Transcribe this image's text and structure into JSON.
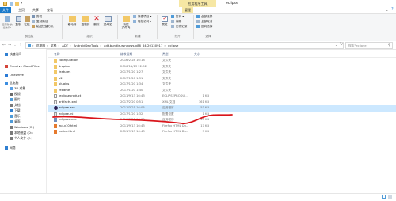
{
  "window": {
    "title": "eclipse",
    "context_tab_label": "应用程序工具",
    "accent": "#1979ca",
    "context_color": "#f6e7a4",
    "selection_color": "#cce8ff",
    "annotation_color": "#d9151b"
  },
  "tabs": [
    "文件",
    "主页",
    "共享",
    "查看",
    "管理"
  ],
  "ribbon": {
    "clipboard": {
      "pin_label": "固定到\"快速访问\"",
      "copy_label": "复制",
      "paste_label": "粘贴",
      "cut_label": "剪切",
      "copy_path_label": "复制路径",
      "paste_shortcut_label": "粘贴快捷方式",
      "group_label": "剪贴板"
    },
    "organize": {
      "move_to_label": "移动到",
      "copy_to_label": "复制到",
      "delete_label": "删除",
      "rename_label": "重命名",
      "group_label": "组织"
    },
    "new": {
      "new_folder_label": "新建\n文件夹",
      "new_item_label": "新建项目 ▾",
      "easy_access_label": "轻松访问 ▾",
      "group_label": "新建"
    },
    "open": {
      "properties_label": "属性",
      "open_label": "打开 ▾",
      "edit_label": "编辑",
      "history_label": "历史记录",
      "group_label": "打开"
    },
    "select": {
      "select_all_label": "全部选择",
      "select_none_label": "全部取消",
      "invert_label": "反向选择",
      "group_label": "选择"
    }
  },
  "address": {
    "segments": [
      "此电脑",
      "文档",
      "ADT",
      "AndroidDevTools",
      "adt-bundle-windows-x86_64-20130917",
      "eclipse"
    ],
    "separator": "›",
    "search_placeholder": "搜索\"eclipse\""
  },
  "nav_items": [
    {
      "label": "快速访问",
      "icon": "star-icon",
      "color": "#2f7fd1"
    },
    {
      "label": "Creative Cloud Files",
      "icon": "cloud-icon",
      "color": "#d4453a"
    },
    {
      "label": "OneDrive",
      "icon": "onedrive-icon",
      "color": "#2a7ad6"
    },
    {
      "label": "此电脑",
      "icon": "computer-icon",
      "color": "#3c8ee0"
    },
    {
      "label": "3D 对象",
      "icon": "cube-icon",
      "color": "#5aa0e6"
    },
    {
      "label": "视频",
      "icon": "video-icon",
      "color": "#6a6a6a"
    },
    {
      "label": "图片",
      "icon": "picture-icon",
      "color": "#4f9bd8"
    },
    {
      "label": "文档",
      "icon": "document-icon",
      "color": "#7a7a7a"
    },
    {
      "label": "下载",
      "icon": "download-icon",
      "color": "#2f7fd1"
    },
    {
      "label": "音乐",
      "icon": "music-icon",
      "color": "#4f9bd8"
    },
    {
      "label": "桌面",
      "icon": "desktop-icon",
      "color": "#4f9bd8"
    },
    {
      "label": "Windows (C:)",
      "icon": "drive-icon",
      "color": "#7a7a7a"
    },
    {
      "label": "本地磁盘 (D:)",
      "icon": "drive-icon",
      "color": "#7a7a7a"
    },
    {
      "label": "个人文件 (E:)",
      "icon": "drive-icon",
      "color": "#7a7a7a"
    },
    {
      "label": "网络",
      "icon": "network-icon",
      "color": "#2f7fd1"
    }
  ],
  "columns": {
    "name": "名称",
    "date": "修改日期",
    "type": "类型",
    "size": "大小"
  },
  "files": [
    {
      "name": "configuration",
      "date": "2016/2/28 16:18",
      "type": "文件夹",
      "size": "",
      "icon": "folder"
    },
    {
      "name": "dropins",
      "date": "2016/11/13 22:52",
      "type": "文件夹",
      "size": "",
      "icon": "folder"
    },
    {
      "name": "features",
      "date": "2017/1/20 1:27",
      "type": "文件夹",
      "size": "",
      "icon": "folder"
    },
    {
      "name": "p2",
      "date": "2017/1/20 1:31",
      "type": "文件夹",
      "size": "",
      "icon": "folder"
    },
    {
      "name": "plugins",
      "date": "2017/1/20 1:34",
      "type": "文件夹",
      "size": "",
      "icon": "folder"
    },
    {
      "name": "readme",
      "date": "2017/1/20 1:40",
      "type": "文件夹",
      "size": "",
      "icon": "folder"
    },
    {
      "name": ".eclipseproduct",
      "date": "2011/9/13 16:43",
      "type": "ECLIPSEPRODU...",
      "size": "1 KB",
      "icon": "file"
    },
    {
      "name": "artifacts.xml",
      "date": "2017/2/20 0:51",
      "type": "XML 文档",
      "size": "161 KB",
      "icon": "xml"
    },
    {
      "name": "eclipse.exe",
      "date": "2011/3/21 16:05",
      "type": "应用程序",
      "size": "53 KB",
      "icon": "eclipse",
      "selected": true
    },
    {
      "name": "eclipse.ini",
      "date": "2017/1/20 1:32",
      "type": "配置设置",
      "size": "1 KB",
      "icon": "ini"
    },
    {
      "name": "eclipsec.exe",
      "date": "2011/3/21 16:05",
      "type": "应用程序",
      "size": "25 KB",
      "icon": "exe"
    },
    {
      "name": "epl-v10.html",
      "date": "2011/9/13 16:43",
      "type": "Firefox HTML Do...",
      "size": "17 KB",
      "icon": "html"
    },
    {
      "name": "notice.html",
      "date": "2011/9/13 16:43",
      "type": "Firefox HTML Do...",
      "size": "9 KB",
      "icon": "html"
    }
  ],
  "status": {
    "text": ""
  }
}
